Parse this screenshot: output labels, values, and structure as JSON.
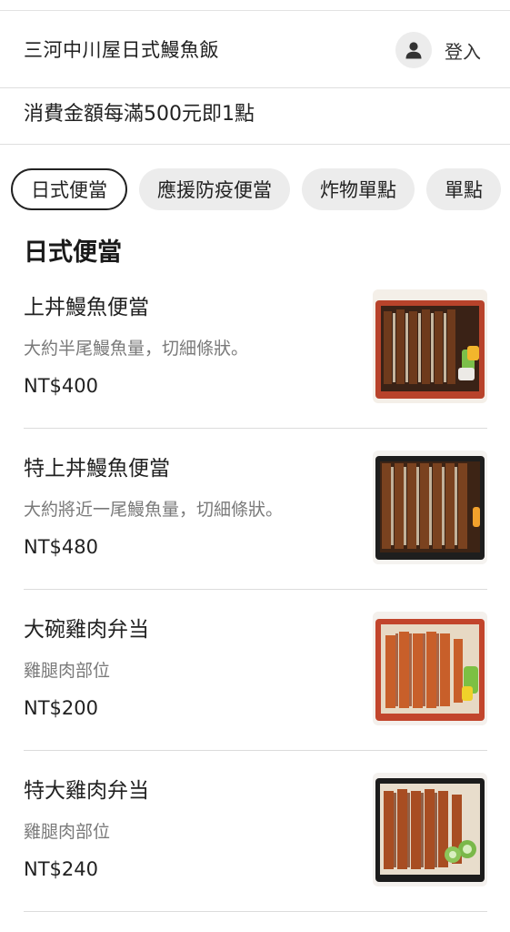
{
  "header": {
    "store_name": "三河中川屋日式鰻魚飯",
    "login_label": "登入"
  },
  "promo": {
    "points_text": "消費金額每滿500元即1點"
  },
  "tabs": [
    {
      "label": "日式便當",
      "active": true
    },
    {
      "label": "應援防疫便當",
      "active": false
    },
    {
      "label": "炸物單點",
      "active": false
    },
    {
      "label": "單點",
      "active": false
    }
  ],
  "section": {
    "title": "日式便當"
  },
  "items": [
    {
      "name": "上丼鰻魚便當",
      "description": "大約半尾鰻魚量，切細條狀。",
      "price": "NT$400",
      "image": "eel-bento-photo"
    },
    {
      "name": "特上丼鰻魚便當",
      "description": "大約將近一尾鰻魚量，切細條狀。",
      "price": "NT$480",
      "image": "eel-bento-photo"
    },
    {
      "name": "大碗雞肉弁当",
      "description": "雞腿肉部位",
      "price": "NT$200",
      "image": "chicken-bento-photo"
    },
    {
      "name": "特大雞肉弁当",
      "description": "雞腿肉部位",
      "price": "NT$240",
      "image": "chicken-bento-photo"
    }
  ],
  "colors": {
    "accent": "#222222",
    "tab_bg": "#ececec",
    "divider": "#dedede"
  }
}
